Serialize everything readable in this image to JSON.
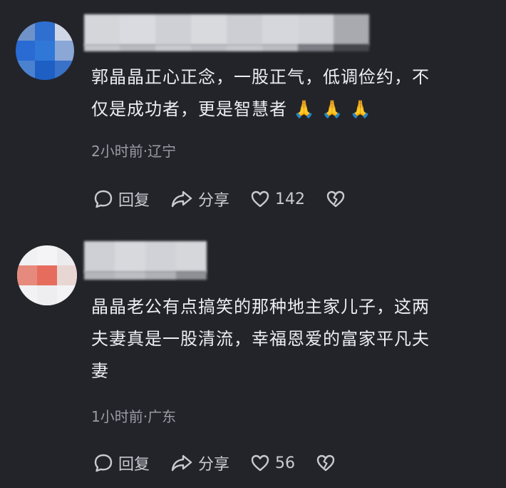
{
  "comments": [
    {
      "text_lines": [
        "郭晶晶正心正念，一股正气，低调俭约，不",
        "仅是成功者，更是智慧者 🙏 🙏 🙏"
      ],
      "meta": "2小时前·辽宁",
      "reply_label": "回复",
      "share_label": "分享",
      "like_count": "142"
    },
    {
      "text_lines": [
        "晶晶老公有点搞笑的那种地主家儿子，这两",
        "夫妻真是一股清流，幸福恩爱的富家平凡夫",
        "妻"
      ],
      "meta": "1小时前·广东",
      "reply_label": "回复",
      "share_label": "分享",
      "like_count": "56"
    }
  ],
  "icons": {
    "reply": "speech-bubble-icon",
    "share": "share-arrow-icon",
    "like": "heart-outline-icon",
    "dislike": "broken-heart-icon"
  },
  "colors": {
    "background": "#23242a",
    "text": "#eceef2",
    "meta": "#9a9ca5",
    "action": "#c9cbd2"
  }
}
